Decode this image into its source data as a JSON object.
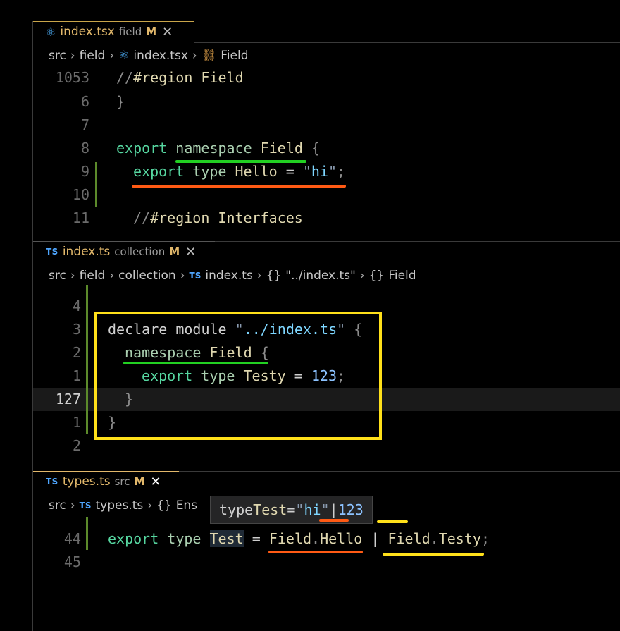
{
  "colors": {
    "accent_tab": "#e2b86b",
    "gutter_modified": "#5c8a2b",
    "underline_green": "#22d022",
    "underline_orange": "#ff5a14",
    "box_yellow": "#ffe01a"
  },
  "pane1": {
    "tab": {
      "icon": "react-icon",
      "name": "index.tsx",
      "desc": "field",
      "mod": "M",
      "close": "✕"
    },
    "crumbs": [
      "src",
      "field",
      "index.tsx",
      "Field"
    ],
    "lines": [
      {
        "num": "1053",
        "text_a": "//",
        "text_b": "#region Field"
      },
      {
        "num": "6",
        "text": "}"
      },
      {
        "num": "7",
        "text": ""
      },
      {
        "num": "8",
        "kw": "export",
        "kw2": "namespace",
        "name": "Field",
        "brace": "{"
      },
      {
        "num": "9",
        "kw": "export",
        "kw2": "type",
        "name": "Hello",
        "eq": "=",
        "q1": "\"",
        "str": "hi",
        "q2": "\"",
        "semi": ";"
      },
      {
        "num": "10",
        "text": ""
      },
      {
        "num": "11",
        "text_a": "//",
        "text_b": "#region Interfaces"
      }
    ]
  },
  "pane2": {
    "tab": {
      "icon": "ts-icon",
      "ts": "TS",
      "name": "index.ts",
      "desc": "collection",
      "mod": "M",
      "close": "✕"
    },
    "crumbs": [
      "src",
      "field",
      "collection",
      "TS",
      "index.ts",
      "{}",
      "\"../index.ts\"",
      "{}",
      "Field"
    ],
    "lines": [
      {
        "num": "4"
      },
      {
        "num": "3",
        "kw": "declare",
        "kw2": "module",
        "q1": "\"",
        "str": "../index.ts",
        "q2": "\"",
        "brace": "{"
      },
      {
        "num": "2",
        "kw2": "namespace",
        "name": "Field",
        "brace": "{"
      },
      {
        "num": "1",
        "kw": "export",
        "kw2": "type",
        "name": "Testy",
        "eq": "=",
        "numval": "123",
        "semi": ";"
      },
      {
        "num": "127",
        "brace": "}"
      },
      {
        "num": "1",
        "brace": "}"
      },
      {
        "num": "2"
      }
    ]
  },
  "pane3": {
    "tab": {
      "icon": "ts-icon",
      "ts": "TS",
      "name": "types.ts",
      "desc": "src",
      "mod": "M",
      "close": "✕"
    },
    "crumbs": [
      "src",
      "TS",
      "types.ts",
      "{}",
      "Ens"
    ],
    "hover": {
      "kw2": "type",
      "name": "Test",
      "eq": "=",
      "q1": "\"",
      "str": "hi",
      "q2": "\"",
      "bar": "|",
      "numval": "123"
    },
    "lines": [
      {
        "num": "44",
        "kw": "export",
        "kw2": "type",
        "name": "Test",
        "eq": "=",
        "ns1": "Field",
        "dot1": ".",
        "m1": "Hello",
        "bar": "|",
        "ns2": "Field",
        "dot2": ".",
        "m2": "Testy",
        "semi": ";"
      },
      {
        "num": "45"
      }
    ]
  }
}
